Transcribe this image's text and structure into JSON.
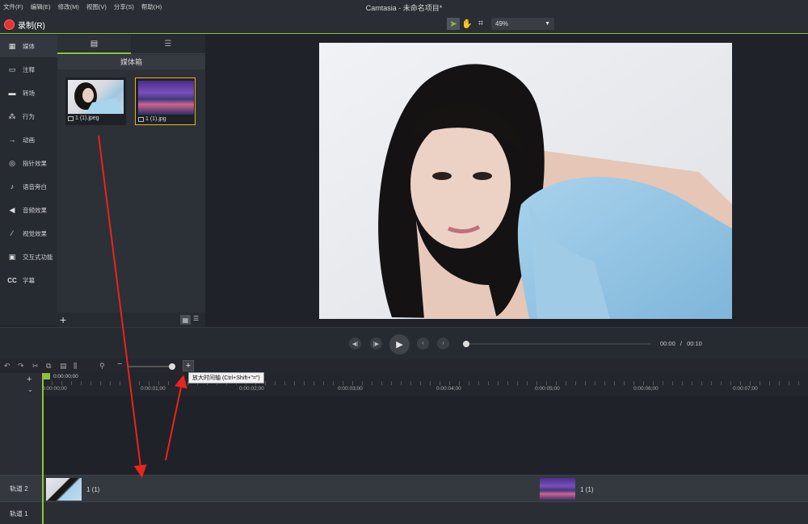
{
  "window_title": "Camtasia - 未命名项目*",
  "menu": [
    "文件(F)",
    "编辑(E)",
    "修改(M)",
    "视图(V)",
    "分享(S)",
    "帮助(H)"
  ],
  "toolbar": {
    "record_label": "录制(R)",
    "zoom_value": "49%"
  },
  "sidebar": {
    "items": [
      {
        "label": "媒体",
        "icon": "media-icon"
      },
      {
        "label": "注释",
        "icon": "annotation-icon"
      },
      {
        "label": "转场",
        "icon": "transition-icon"
      },
      {
        "label": "行为",
        "icon": "behavior-icon"
      },
      {
        "label": "动画",
        "icon": "animation-icon"
      },
      {
        "label": "指针效果",
        "icon": "cursor-effect-icon"
      },
      {
        "label": "语音旁白",
        "icon": "microphone-icon"
      },
      {
        "label": "音频效果",
        "icon": "audio-effect-icon"
      },
      {
        "label": "视觉效果",
        "icon": "visual-effect-icon"
      },
      {
        "label": "交互式功能",
        "icon": "interactive-icon"
      },
      {
        "label": "字幕",
        "icon": "cc-icon"
      }
    ]
  },
  "media_bin": {
    "title": "媒体箱",
    "items": [
      {
        "label": "1 (1).jpeg"
      },
      {
        "label": "1 (1).jpg"
      }
    ]
  },
  "player": {
    "current_time": "00:00",
    "separator": "/",
    "total_time": "00:10"
  },
  "timeline": {
    "tooltip": "放大时间轴 (Ctrl+Shift+\"=\")",
    "playhead_time": "0:00:00;00",
    "ruler": [
      "0:00:00;00",
      "0:00:01;00",
      "0:00:02;00",
      "0:00:03;00",
      "0:00:04;00",
      "0:00:05;00",
      "0:00:06;00",
      "0:00:07;00"
    ],
    "tracks": [
      {
        "label": "轨道 2",
        "clips": [
          {
            "label": "1 (1)"
          },
          {
            "label": "1 (1)"
          }
        ]
      },
      {
        "label": "轨道 1"
      }
    ]
  },
  "colors": {
    "accent": "#8fc23e",
    "record": "#e8322f",
    "selection": "#f0b21c",
    "annotation_arrow": "#e8251d"
  }
}
